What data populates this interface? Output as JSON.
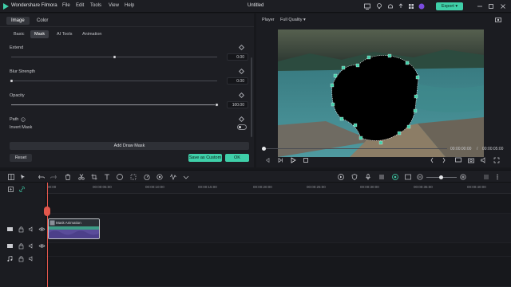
{
  "app": {
    "name": "Wondershare Filmora",
    "project_title": "Untitled"
  },
  "menu": [
    "File",
    "Edit",
    "Tools",
    "View",
    "Help"
  ],
  "export_label": "Export",
  "tabs": {
    "top": [
      "Image",
      "Color"
    ],
    "sub": [
      "Basic",
      "Mask",
      "AI Tools",
      "Animation"
    ]
  },
  "properties": {
    "extend": {
      "label": "Extend",
      "value": "0.00",
      "level": 0.5
    },
    "blur_strength": {
      "label": "Blur Strength",
      "value": "0.00",
      "level": 0.0
    },
    "opacity": {
      "label": "Opacity",
      "value": "100.00",
      "level": 1.0
    },
    "path_label": "Path",
    "invert_label": "Invert Mask"
  },
  "buttons": {
    "add_draw_mask": "Add Draw Mask",
    "reset": "Reset",
    "save_custom": "Save as Custom",
    "ok": "OK"
  },
  "player": {
    "label": "Player",
    "quality": "Full Quality",
    "current_time": "00:00:00:00",
    "separator": "/",
    "total_time": "00:00:05:00"
  },
  "timeline": {
    "ruler": [
      "00:00",
      "00:00:05:00",
      "00:00:10:00",
      "00:00:15:00",
      "00:00:20:00",
      "00:00:25:00",
      "00:00:30:00",
      "00:00:35:00",
      "00:00:40:00"
    ],
    "clip_name": "Mask Animation"
  },
  "colors": {
    "accent": "#3fcfa9",
    "playhead": "#e2574c",
    "panel": "#1d1e23"
  }
}
